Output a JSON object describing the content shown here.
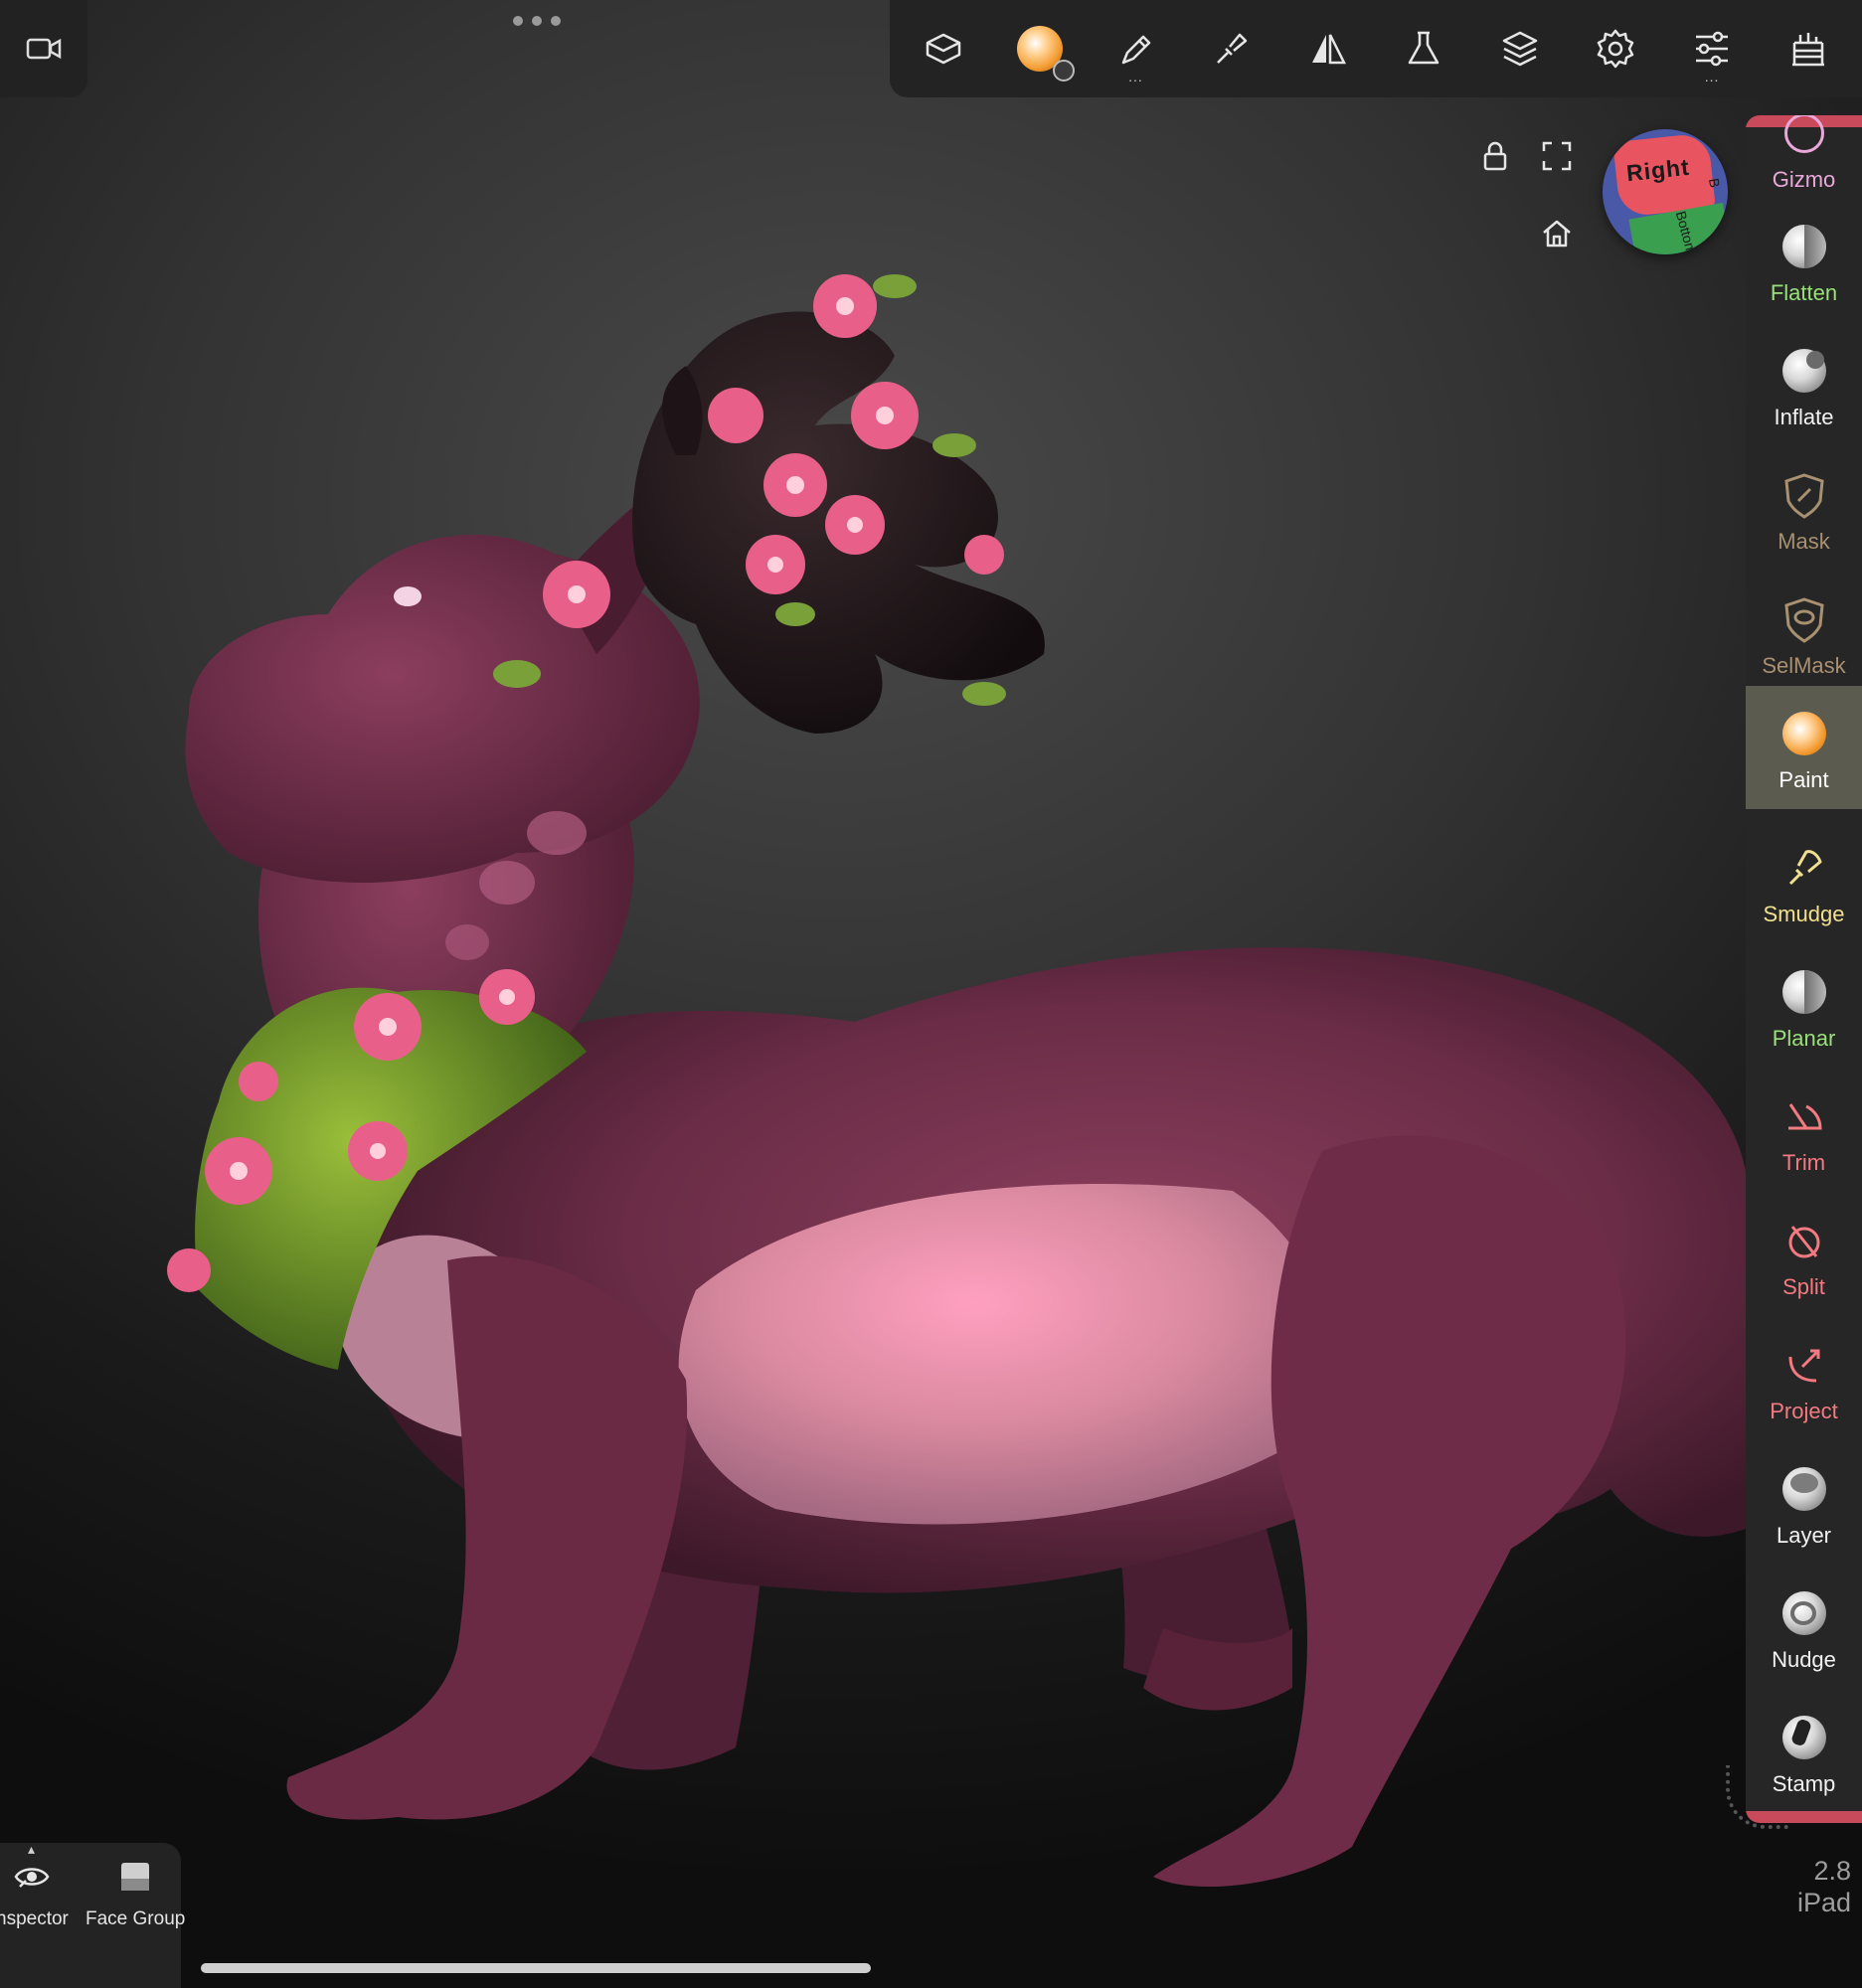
{
  "toolbar": {
    "items": [
      {
        "name": "scene-icon"
      },
      {
        "name": "material-icon"
      },
      {
        "name": "stroke-icon",
        "more": "..."
      },
      {
        "name": "paint-icon"
      },
      {
        "name": "symmetry-icon"
      },
      {
        "name": "tools-icon"
      },
      {
        "name": "layers-icon"
      },
      {
        "name": "settings-icon"
      },
      {
        "name": "sliders-icon",
        "more": "..."
      },
      {
        "name": "history-icon"
      }
    ]
  },
  "viewport": {
    "nav_cube": {
      "front": "Right",
      "side": "B",
      "bottom": "Bottom"
    }
  },
  "tools": [
    {
      "label": "Gizmo",
      "color": "#e8a8d8"
    },
    {
      "label": "Flatten",
      "color": "#9ae07a"
    },
    {
      "label": "Inflate",
      "color": "#f2f2f2"
    },
    {
      "label": "Mask",
      "color": "#a89070"
    },
    {
      "label": "SelMask",
      "color": "#a89070"
    },
    {
      "label": "Paint",
      "color": "#ffffff",
      "active": true
    },
    {
      "label": "Smudge",
      "color": "#f0e090"
    },
    {
      "label": "Planar",
      "color": "#9ae07a"
    },
    {
      "label": "Trim",
      "color": "#f47a82"
    },
    {
      "label": "Split",
      "color": "#f47a82"
    },
    {
      "label": "Project",
      "color": "#f47a82"
    },
    {
      "label": "Layer",
      "color": "#f2f2f2"
    },
    {
      "label": "Nudge",
      "color": "#f2f2f2"
    },
    {
      "label": "Stamp",
      "color": "#f2f2f2"
    }
  ],
  "version": {
    "number": "2.8",
    "device": "iPad"
  },
  "bottom_panel": {
    "inspector_label": "nspector",
    "face_group_label": "Face Group",
    "caret": "▴"
  }
}
